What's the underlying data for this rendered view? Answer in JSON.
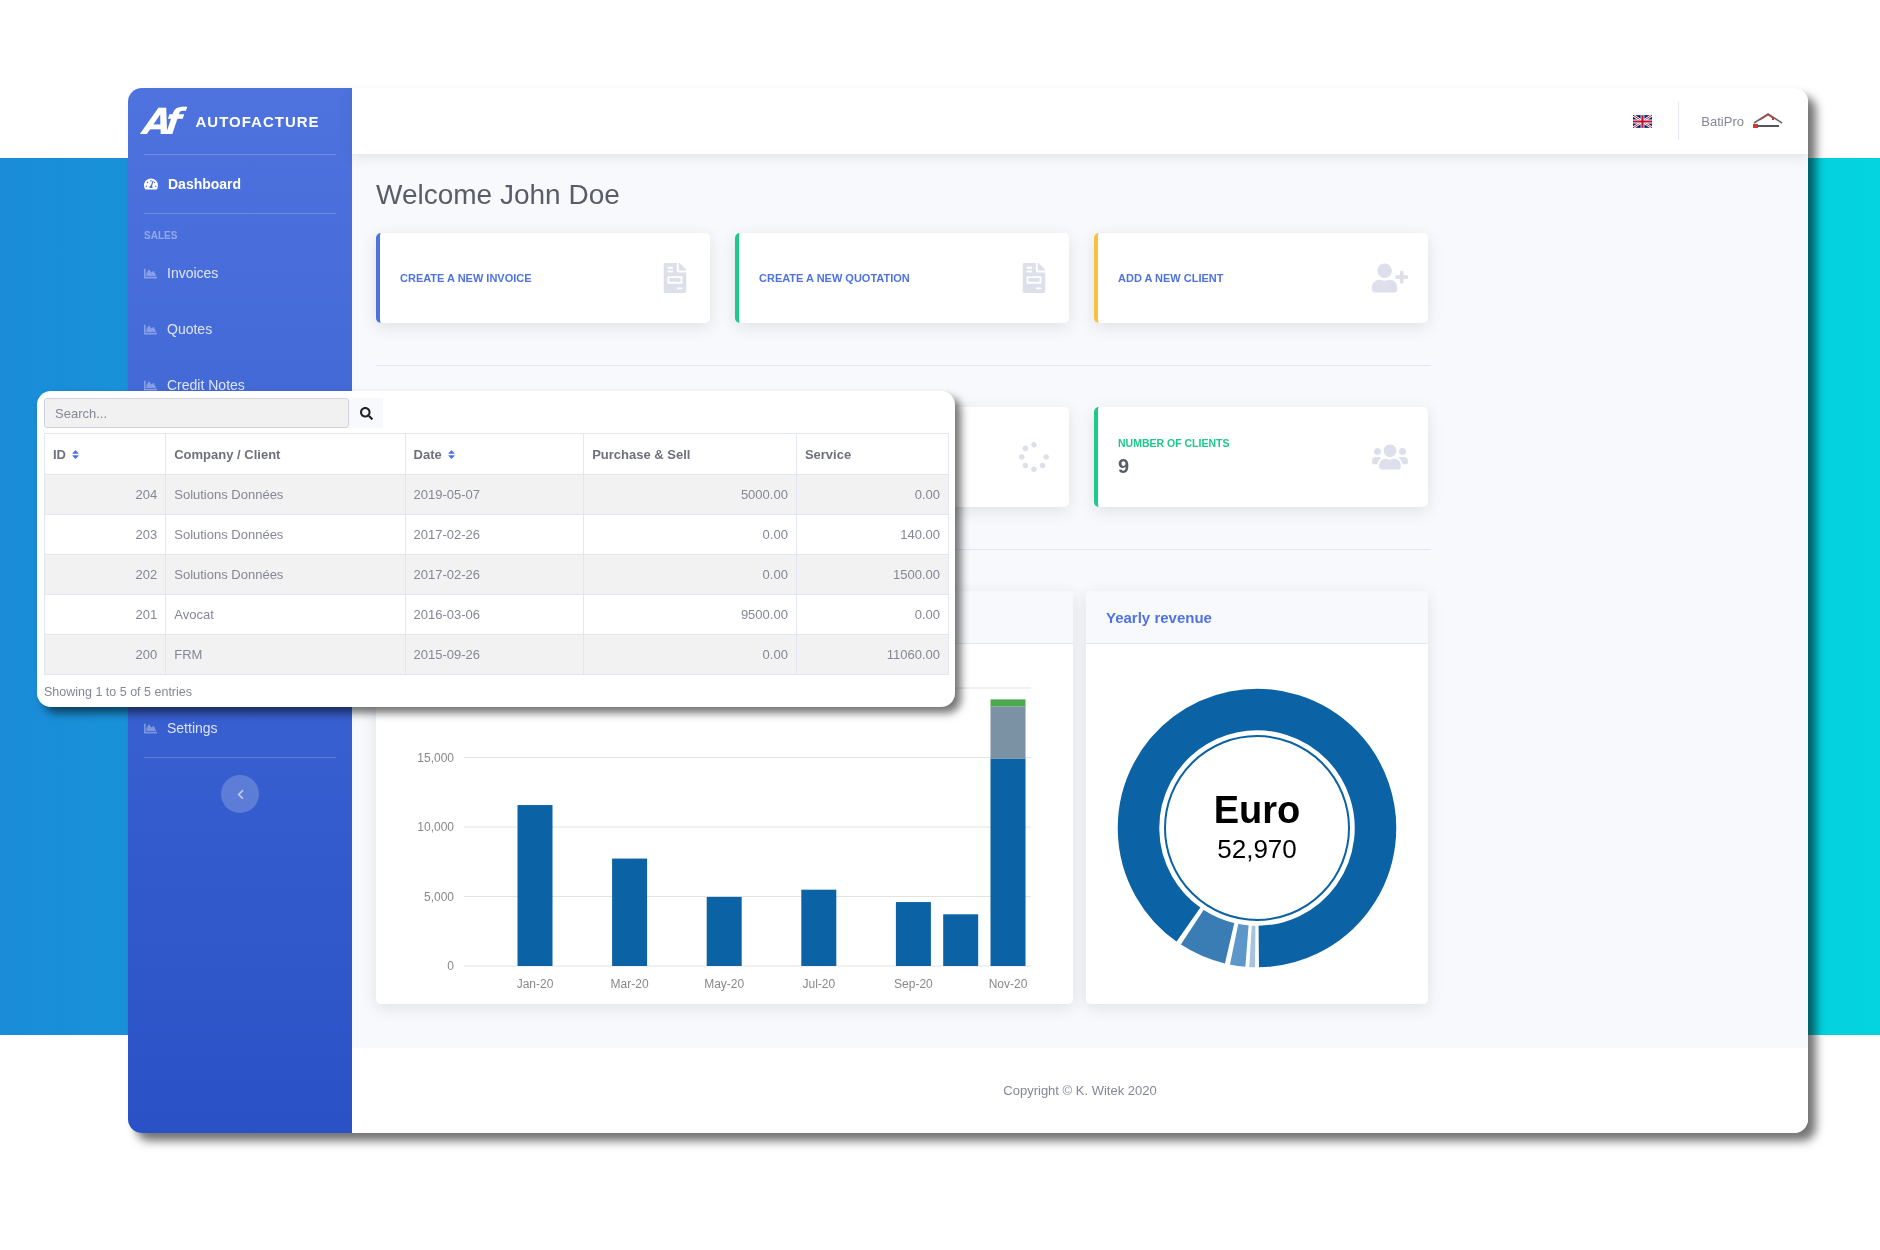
{
  "sidebar": {
    "logo_text": "Af",
    "brand": "AUTOFACTURE",
    "main_items": [
      {
        "label": "Dashboard",
        "kind": "dashboard",
        "selected": true
      }
    ],
    "section": "SALES",
    "section_items": [
      {
        "label": "Invoices",
        "kind": "chart",
        "selected": false
      },
      {
        "label": "Quotes",
        "kind": "chart",
        "selected": false
      },
      {
        "label": "Credit Notes",
        "kind": "chart",
        "selected": false
      }
    ],
    "bottom_items": [
      {
        "label": "Settings",
        "kind": "chart",
        "selected": false
      }
    ]
  },
  "topbar": {
    "user": "BatiPro"
  },
  "welcome": "Welcome John Doe",
  "actions": [
    {
      "label": "CREATE A NEW INVOICE",
      "color": "#4e73df",
      "kind": "document"
    },
    {
      "label": "CREATE A NEW QUOTATION",
      "color": "#1cc88a",
      "kind": "document"
    },
    {
      "label": "ADD A NEW CLIENT",
      "color": "#f6c23e",
      "kind": "add-person"
    }
  ],
  "stats": [
    {
      "kind": "loading"
    },
    {
      "kind": "count",
      "label": "NUMBER OF CLIENTS",
      "value": "9",
      "color": "#1cc88a"
    }
  ],
  "revenue_chart": {
    "chart_data": {
      "type": "bar",
      "stacked": true,
      "grid": true,
      "categories": [
        "Jan-20",
        null,
        "Mar-20",
        null,
        "May-20",
        null,
        "Jul-20",
        null,
        "Sep-20",
        null,
        "Nov-20"
      ],
      "ylim": [
        0,
        20000
      ],
      "yticks": [
        {
          "value": 0,
          "label": "0"
        },
        {
          "value": 5000,
          "label": "5,000"
        },
        {
          "value": 10000,
          "label": "10,000"
        },
        {
          "value": 15000,
          "label": "15,000"
        }
      ],
      "series": [
        {
          "color": "#0b62a4",
          "values": [
            11580,
            null,
            7730,
            null,
            4970,
            null,
            5490,
            null,
            4600,
            3720,
            14930
          ]
        },
        {
          "color": "#7a92a3",
          "values": [
            null,
            null,
            null,
            null,
            null,
            null,
            null,
            null,
            null,
            null,
            3750
          ]
        },
        {
          "color": "#4da74d",
          "values": [
            null,
            null,
            null,
            null,
            null,
            null,
            null,
            null,
            null,
            null,
            500
          ]
        }
      ]
    }
  },
  "yearly_revenue": {
    "title": "Yearly revenue",
    "currency": "Euro",
    "total": "52,970"
  },
  "footer": "Copyright © K. Witek 2020",
  "table_panel": {
    "search": {
      "placeholder": "Search..."
    },
    "columns": [
      {
        "label": "ID",
        "kind": "number",
        "sortable": true
      },
      {
        "label": "Company / Client",
        "kind": "text",
        "sortable": false
      },
      {
        "label": "Date",
        "kind": "text",
        "sortable": true
      },
      {
        "label": "Purchase & Sell",
        "kind": "number",
        "sortable": false
      },
      {
        "label": "Service",
        "kind": "number",
        "sortable": false
      }
    ],
    "rows": [
      [
        "204",
        "Solutions Données",
        "2019-05-07",
        "5000.00",
        "0.00"
      ],
      [
        "203",
        "Solutions Données",
        "2017-02-26",
        "0.00",
        "140.00"
      ],
      [
        "202",
        "Solutions Données",
        "2017-02-26",
        "0.00",
        "1500.00"
      ],
      [
        "201",
        "Avocat",
        "2016-03-06",
        "9500.00",
        "0.00"
      ],
      [
        "200",
        "FRM",
        "2015-09-26",
        "0.00",
        "11060.00"
      ]
    ],
    "info": "Showing 1 to 5 of 5 entries"
  }
}
